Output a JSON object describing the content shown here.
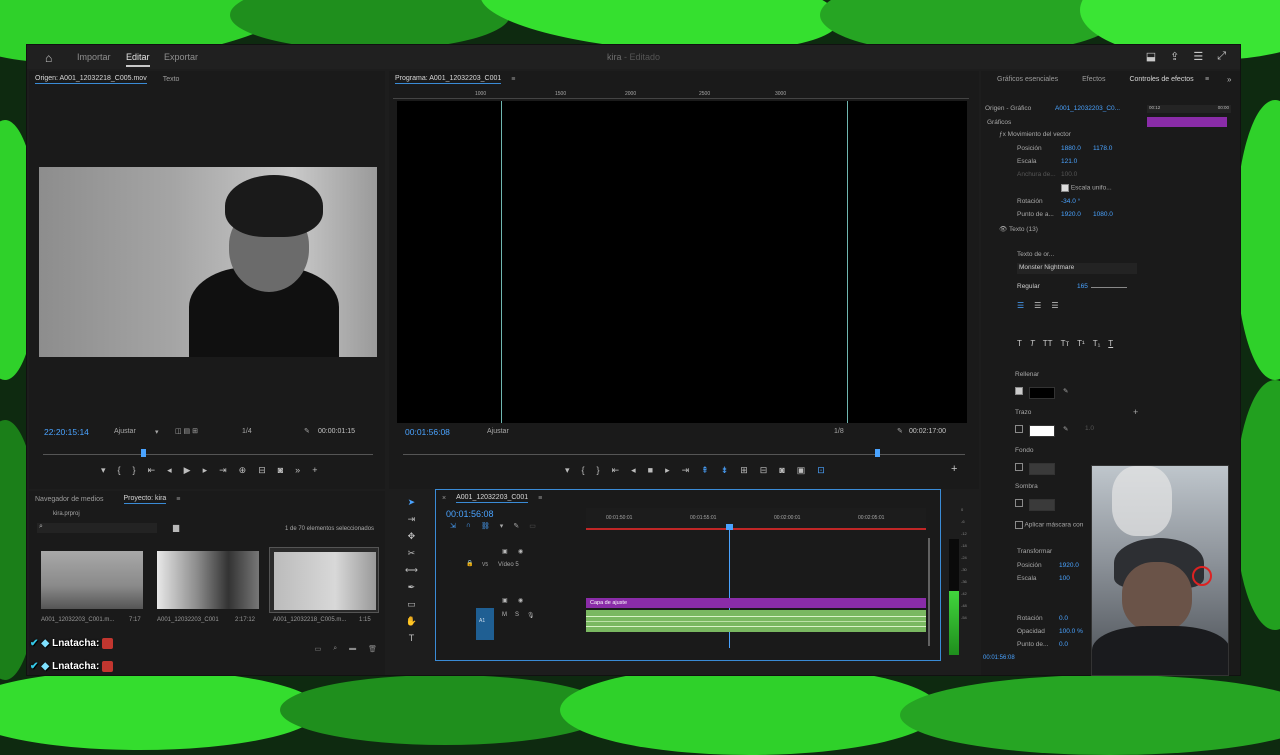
{
  "topbar": {
    "nav": [
      "Importar",
      "Editar",
      "Exportar"
    ],
    "active": "Editar",
    "project_title": "kira",
    "project_state": "- Editado"
  },
  "source": {
    "tab_origin": "Origen: A001_12032218_C005.mov",
    "tab_text": "Texto",
    "timecode": "22:20:15:14",
    "fit": "Ajustar",
    "resolution": "1/4",
    "duration": "00:00:01:15"
  },
  "program": {
    "tab": "Programa: A001_12032203_C001",
    "timecode": "00:01:56:08",
    "fit": "Ajustar",
    "resolution": "1/8",
    "duration": "00:02:17:00",
    "ruler_marks": [
      "1000",
      "1500",
      "2000",
      "2500",
      "3000"
    ]
  },
  "project": {
    "tab_media": "Navegador de medios",
    "tab_project": "Proyecto: kira",
    "file_name": "kira.prproj",
    "selection": "1 de 70 elementos seleccionados",
    "thumbs": [
      {
        "name": "A001_12032203_C001.m...",
        "duration": "7:17"
      },
      {
        "name": "A001_12032203_C001",
        "duration": "2:17:12"
      },
      {
        "name": "A001_12032218_C005.m...",
        "duration": "1:15"
      }
    ]
  },
  "timeline": {
    "tab": "A001_12032203_C001",
    "timecode": "00:01:56:08",
    "ruler": [
      "00:01:50:01",
      "00:01:55:01",
      "00:02:00:01",
      "00:02:05:01"
    ],
    "track_v5": "Vídeo 5",
    "track_v": "V5",
    "track_a": "A1",
    "adjustment_clip": "Capa de ajuste",
    "meter_labels": [
      "0",
      "-6",
      "-12",
      "-18",
      "-24",
      "-30",
      "-36",
      "-42",
      "-48",
      "-54"
    ],
    "meter_level": 0.55
  },
  "effects": {
    "tabs": [
      "Gráficos esenciales",
      "Efectos",
      "Controles de efectos"
    ],
    "active_tab": "Controles de efectos",
    "source_label": "Origen - Gráfico",
    "source_clip": "A001_12032203_C0...",
    "mini_times": [
      "00:12",
      "00:00"
    ],
    "section": "Gráficos",
    "vector_motion": "Movimiento del vector",
    "rows": [
      {
        "label": "Posición",
        "v1": "1880.0",
        "v2": "1178.0"
      },
      {
        "label": "Escala",
        "v1": "121.0",
        "v2": ""
      },
      {
        "label": "Anchura de...",
        "v1": "100.0",
        "v2": ""
      },
      {
        "label": "Escala unifo...",
        "v1": "",
        "v2": ""
      },
      {
        "label": "Rotación",
        "v1": "-34.0 °",
        "v2": ""
      },
      {
        "label": "Punto de a...",
        "v1": "1920.0",
        "v2": "1080.0"
      }
    ],
    "text_layer": "Texto (13)",
    "text_origin": "Texto de or...",
    "font": "Monster Nightmare",
    "font_style": "Regular",
    "font_size": "165",
    "fill": "Rellenar",
    "stroke": "Trazo",
    "stroke_value": "1.0",
    "background": "Fondo",
    "shadow": "Sombra",
    "mask": "Aplicar máscara con",
    "transform": "Transformar",
    "t_rows": [
      {
        "label": "Posición",
        "v1": "1920.0"
      },
      {
        "label": "Escala",
        "v1": "100"
      },
      {
        "label": "Escala h...",
        "v1": "100"
      },
      {
        "label": "Escala",
        "v1": ""
      },
      {
        "label": "Rotación",
        "v1": "0.0"
      },
      {
        "label": "Opacidad",
        "v1": "100.0 %"
      },
      {
        "label": "Punto de...",
        "v1": "0.0"
      }
    ],
    "bottom_tc": "00:01:56:08"
  },
  "chat": [
    {
      "user": "Lnatacha:"
    },
    {
      "user": "Lnatacha:"
    }
  ],
  "colors": {
    "accent": "#4aa3ff",
    "adjustment": "#8a2ca8",
    "audio": "#7ab861",
    "slime": "#2fd12a"
  }
}
